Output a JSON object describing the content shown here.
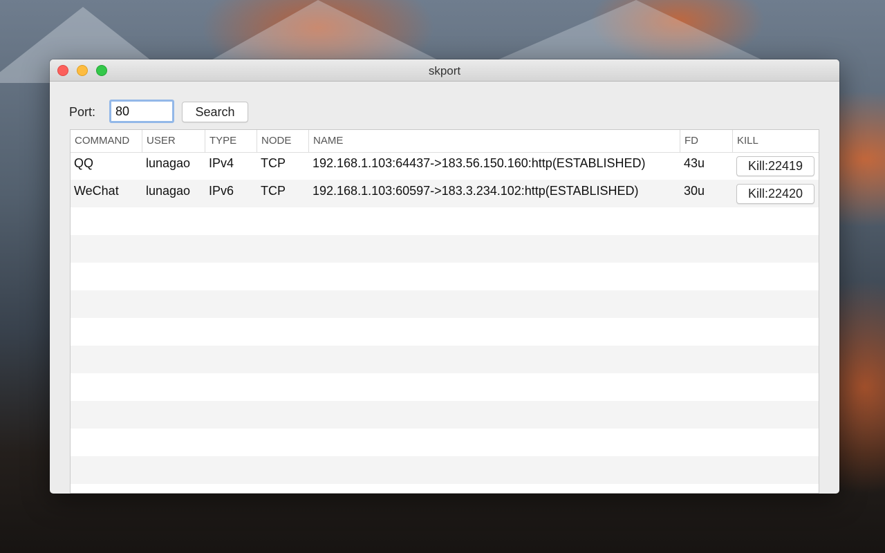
{
  "window": {
    "title": "skport"
  },
  "search": {
    "port_label": "Port:",
    "port_value": "80",
    "button_label": "Search"
  },
  "table": {
    "columns": [
      "COMMAND",
      "USER",
      "TYPE",
      "NODE",
      "NAME",
      "FD",
      "KILL"
    ],
    "rows": [
      {
        "command": "QQ",
        "user": "lunagao",
        "type": "IPv4",
        "node": "TCP",
        "name": "192.168.1.103:64437->183.56.150.160:http(ESTABLISHED)",
        "fd": "43u",
        "kill_label": "Kill:22419"
      },
      {
        "command": "WeChat",
        "user": "lunagao",
        "type": "IPv6",
        "node": "TCP",
        "name": "192.168.1.103:60597->183.3.234.102:http(ESTABLISHED)",
        "fd": "30u",
        "kill_label": "Kill:22420"
      }
    ]
  },
  "colors": {
    "close": "#fc605c",
    "minimize": "#fdbc40",
    "zoom": "#34c84a",
    "focus_ring": "#93b8e8"
  }
}
